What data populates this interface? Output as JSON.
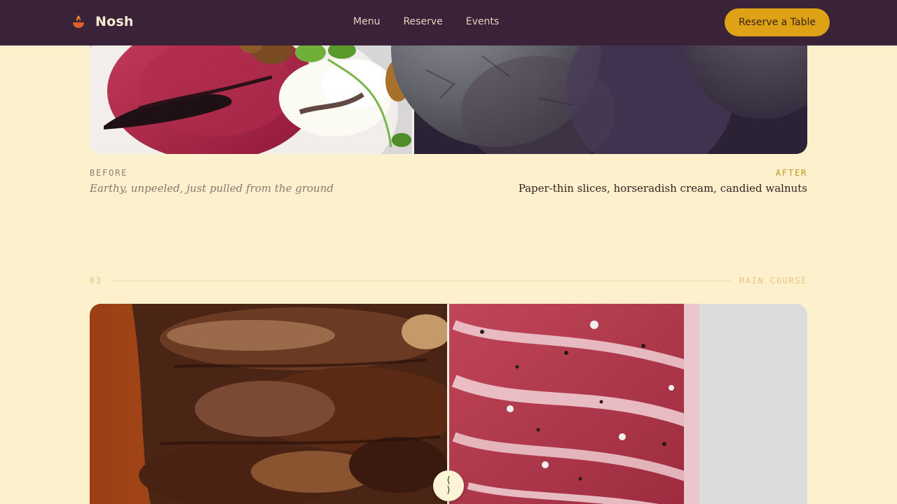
{
  "header": {
    "brand_name": "Nosh",
    "brand_icon": "flame-bowl-icon",
    "nav": [
      "Menu",
      "Reserve",
      "Events"
    ],
    "cta_label": "Reserve a Table"
  },
  "compare_1": {
    "before_label": "BEFORE",
    "before_text": "Earthy, unpeeled, just pulled from the ground",
    "after_label": "AFTER",
    "after_text": "Paper-thin slices, horseradish cream, candied walnuts"
  },
  "section_3": {
    "number": "03",
    "title": "MAIN COURSE"
  },
  "compare_2": {
    "handle_top_glyph": "⟨",
    "handle_bottom_glyph": "⟩"
  },
  "colors": {
    "background": "#fdf0cd",
    "header": "#3a2238",
    "accent": "#dea217"
  }
}
